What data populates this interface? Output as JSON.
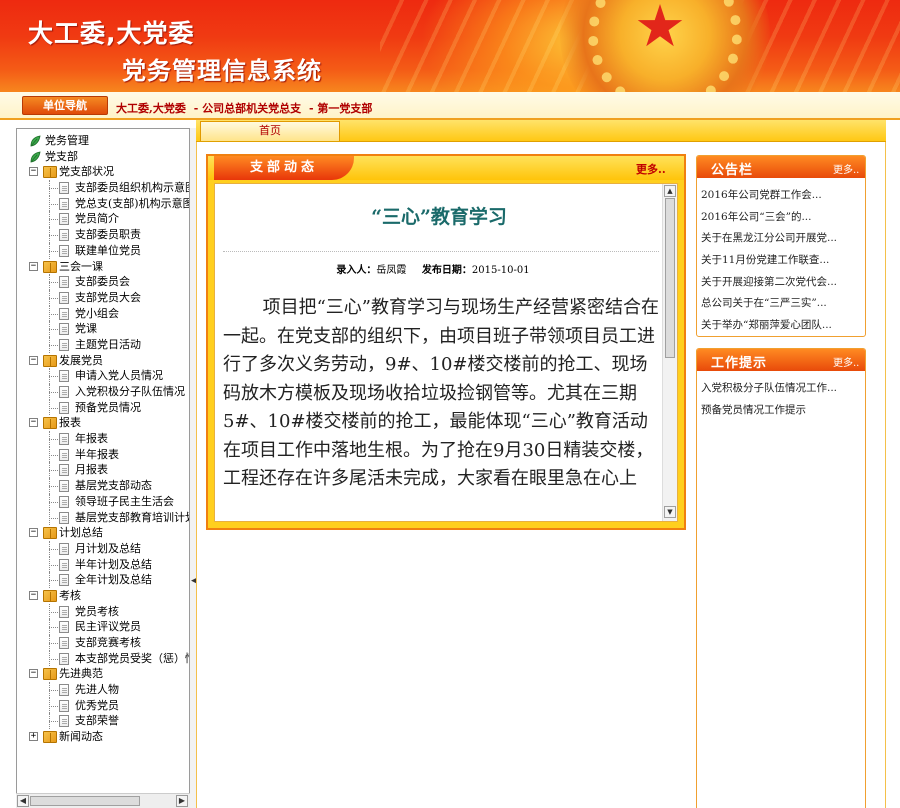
{
  "header": {
    "title_line1": "大工委,大党委",
    "title_line2": "党务管理信息系统"
  },
  "nav": {
    "button_label": "单位导航",
    "breadcrumb": [
      "大工委,大党委",
      "- 公司总部机关党总支",
      "- 第一党支部"
    ]
  },
  "tabs": [
    {
      "label": "首页"
    }
  ],
  "tree": [
    {
      "label": "党务管理",
      "level": 0,
      "icon": "leaf-icon"
    },
    {
      "label": "党支部",
      "level": 0,
      "icon": "leaf-icon"
    },
    {
      "label": "党支部状况",
      "level": 1,
      "icon": "book-icon",
      "expander": "minus"
    },
    {
      "label": "支部委员组织机构示意图",
      "level": 2,
      "icon": "page-icon"
    },
    {
      "label": "党总支(支部)机构示意图",
      "level": 2,
      "icon": "page-icon"
    },
    {
      "label": "党员简介",
      "level": 2,
      "icon": "page-icon"
    },
    {
      "label": "支部委员职责",
      "level": 2,
      "icon": "page-icon"
    },
    {
      "label": "联建单位党员",
      "level": 2,
      "icon": "page-icon"
    },
    {
      "label": "三会一课",
      "level": 1,
      "icon": "book-icon",
      "expander": "minus"
    },
    {
      "label": "支部委员会",
      "level": 2,
      "icon": "page-icon"
    },
    {
      "label": "支部党员大会",
      "level": 2,
      "icon": "page-icon"
    },
    {
      "label": "党小组会",
      "level": 2,
      "icon": "page-icon"
    },
    {
      "label": "党课",
      "level": 2,
      "icon": "page-icon"
    },
    {
      "label": "主题党日活动",
      "level": 2,
      "icon": "page-icon"
    },
    {
      "label": "发展党员",
      "level": 1,
      "icon": "book-icon",
      "expander": "minus"
    },
    {
      "label": "申请入党人员情况",
      "level": 2,
      "icon": "page-icon"
    },
    {
      "label": "入党积极分子队伍情况",
      "level": 2,
      "icon": "page-icon"
    },
    {
      "label": "预备党员情况",
      "level": 2,
      "icon": "page-icon"
    },
    {
      "label": "报表",
      "level": 1,
      "icon": "book-icon",
      "expander": "minus"
    },
    {
      "label": "年报表",
      "level": 2,
      "icon": "page-icon"
    },
    {
      "label": "半年报表",
      "level": 2,
      "icon": "page-icon"
    },
    {
      "label": "月报表",
      "level": 2,
      "icon": "page-icon"
    },
    {
      "label": "基层党支部动态",
      "level": 2,
      "icon": "page-icon"
    },
    {
      "label": "领导班子民主生活会",
      "level": 2,
      "icon": "page-icon"
    },
    {
      "label": "基层党支部教育培训计划",
      "level": 2,
      "icon": "page-icon"
    },
    {
      "label": "计划总结",
      "level": 1,
      "icon": "book-icon",
      "expander": "minus"
    },
    {
      "label": "月计划及总结",
      "level": 2,
      "icon": "page-icon"
    },
    {
      "label": "半年计划及总结",
      "level": 2,
      "icon": "page-icon"
    },
    {
      "label": "全年计划及总结",
      "level": 2,
      "icon": "page-icon"
    },
    {
      "label": "考核",
      "level": 1,
      "icon": "book-icon",
      "expander": "minus"
    },
    {
      "label": "党员考核",
      "level": 2,
      "icon": "page-icon"
    },
    {
      "label": "民主评议党员",
      "level": 2,
      "icon": "page-icon"
    },
    {
      "label": "支部竞赛考核",
      "level": 2,
      "icon": "page-icon"
    },
    {
      "label": "本支部党员受奖（惩）情况",
      "level": 2,
      "icon": "page-icon"
    },
    {
      "label": "先进典范",
      "level": 1,
      "icon": "book-icon",
      "expander": "minus"
    },
    {
      "label": "先进人物",
      "level": 2,
      "icon": "page-icon"
    },
    {
      "label": "优秀党员",
      "level": 2,
      "icon": "page-icon"
    },
    {
      "label": "支部荣誉",
      "level": 2,
      "icon": "page-icon"
    },
    {
      "label": "新闻动态",
      "level": 1,
      "icon": "book-icon",
      "expander": "plus"
    }
  ],
  "news": {
    "tab_label": "支部动态",
    "more_label": "更多..",
    "article_title": "“三心”教育学习",
    "author_label": "录入人：",
    "author": "岳凤霞",
    "date_label": "发布日期：",
    "date": "2015-10-01",
    "body": "项目把“三心”教育学习与现场生产经营紧密结合在一起。在党支部的组织下，由项目班子带领项目员工进行了多次义务劳动，9#、10#楼交楼前的抢工、现场码放木方模板及现场收拾垃圾捡钢管等。尤其在三期5#、10#楼交楼前的抢工，最能体现“三心”教育活动在项目工作中落地生根。为了抢在9月30日精装交楼，工程还存在许多尾活未完成，大家看在眼里急在心上"
  },
  "notice": {
    "title": "公告栏",
    "more": "更多..",
    "items": [
      "2016年公司党群工作会...",
      "2016年公司“三会”的...",
      "关于在黑龙江分公司开展党...",
      "关于11月份党建工作联查...",
      "关于开展迎接第二次党代会...",
      "总公司关于在“三严三实”...",
      "关于举办“郑丽萍爱心团队..."
    ]
  },
  "tips": {
    "title": "工作提示",
    "more": "更多..",
    "items": [
      "入党积极分子队伍情况工作...",
      "预备党员情况工作提示"
    ]
  },
  "colors": {
    "banner_red": "#ee2a10",
    "accent_orange": "#e84a0a",
    "gold": "#ffcf1e",
    "title_teal": "#1a6a6a",
    "breadcrumb_red": "#b00000"
  }
}
